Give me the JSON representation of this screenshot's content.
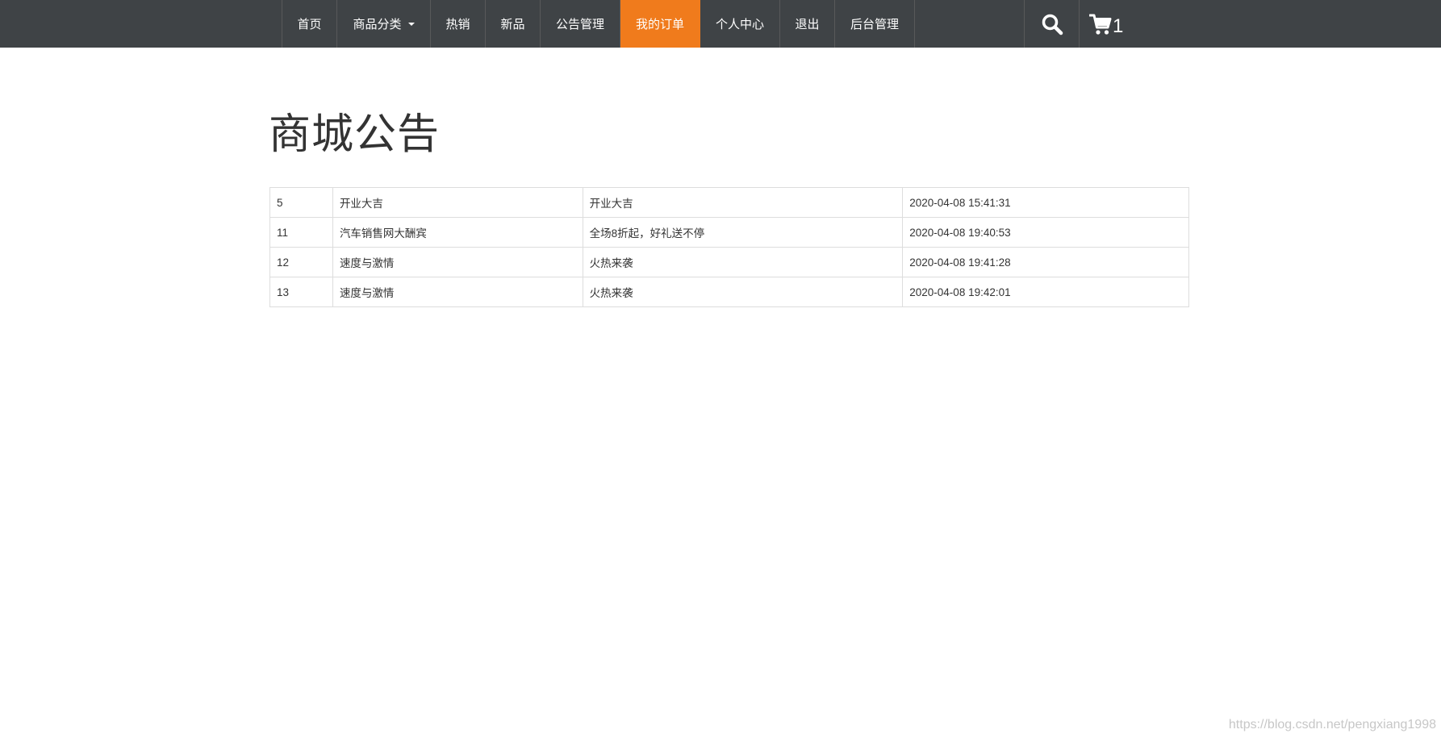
{
  "nav": {
    "items": [
      {
        "label": "首页"
      },
      {
        "label": "商品分类"
      },
      {
        "label": "热销"
      },
      {
        "label": "新品"
      },
      {
        "label": "公告管理"
      },
      {
        "label": "我的订单"
      },
      {
        "label": "个人中心"
      },
      {
        "label": "退出"
      },
      {
        "label": "后台管理"
      }
    ],
    "active_item": "我的订单",
    "search_icon": "search-icon",
    "cart_icon": "cart-icon",
    "cart_count": "1"
  },
  "page": {
    "title": "商城公告"
  },
  "notices": {
    "rows": [
      {
        "id": "5",
        "title": "开业大吉",
        "content": "开业大吉",
        "time": "2020-04-08 15:41:31"
      },
      {
        "id": "11",
        "title": "汽车销售网大酬宾",
        "content": "全场8折起，好礼送不停",
        "time": "2020-04-08 19:40:53"
      },
      {
        "id": "12",
        "title": "速度与激情",
        "content": "火热来袭",
        "time": "2020-04-08 19:41:28"
      },
      {
        "id": "13",
        "title": "速度与激情",
        "content": "火热来袭",
        "time": "2020-04-08 19:42:01"
      }
    ]
  },
  "watermark": "https://blog.csdn.net/pengxiang1998",
  "colors": {
    "navbar_bg": "#3f4346",
    "active_bg": "#f07b1c",
    "border": "#dddddd"
  }
}
